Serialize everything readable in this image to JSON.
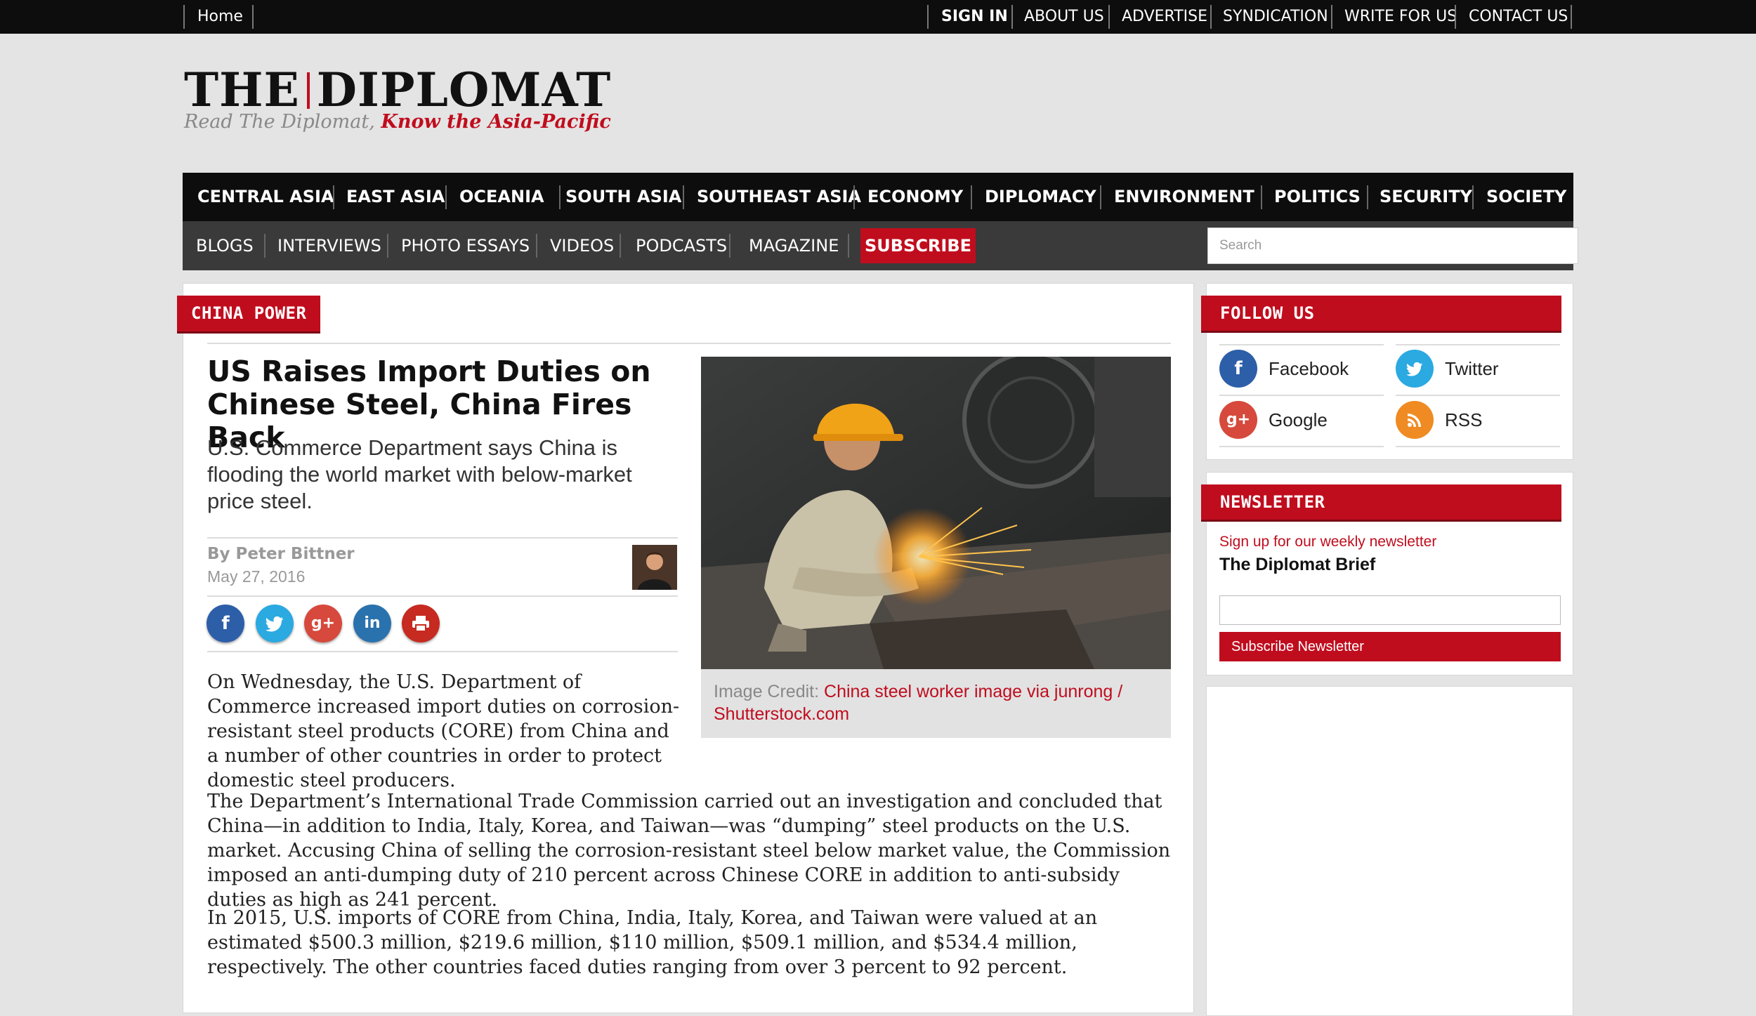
{
  "topbar": {
    "home": "Home",
    "sign_in": "SIGN IN",
    "about": "ABOUT US",
    "advertise": "ADVERTISE",
    "syndication": "SYNDICATION",
    "write": "WRITE FOR US",
    "contact": "CONTACT US"
  },
  "logo": {
    "word_left": "THE",
    "word_right": "DIPLOMAT",
    "tag_plain": "Read The Diplomat, ",
    "tag_bold": "Know the Asia-Pacific"
  },
  "nav_primary": [
    "CENTRAL ASIA",
    "EAST ASIA",
    "OCEANIA",
    "SOUTH ASIA",
    "SOUTHEAST ASIA",
    "ECONOMY",
    "DIPLOMACY",
    "ENVIRONMENT",
    "POLITICS",
    "SECURITY",
    "SOCIETY"
  ],
  "nav_secondary": [
    "BLOGS",
    "INTERVIEWS",
    "PHOTO ESSAYS",
    "VIDEOS",
    "PODCASTS",
    "MAGAZINE"
  ],
  "subscribe_label": "SUBSCRIBE",
  "search_placeholder": "Search",
  "article": {
    "section": "CHINA POWER",
    "headline": "US Raises Import Duties on Chinese Steel, China Fires Back",
    "dek": "U.S. Commerce Department says China is flooding the world market with below-market price steel.",
    "byline": "By Peter Bittner",
    "date": "May 27, 2016",
    "share_icons": [
      "facebook-icon",
      "twitter-icon",
      "google-plus-icon",
      "linkedin-icon",
      "print-icon"
    ],
    "caption_prefix": "Image Credit: ",
    "caption_credit": "China steel worker image via junrong / Shutterstock.com",
    "paragraphs": [
      "On Wednesday, the U.S. Department of Commerce increased import duties on corrosion-resistant steel products (CORE) from China and a number of other countries in order to protect domestic steel producers.",
      "The Department’s International Trade Commission carried out an investigation and concluded that China—in addition to India, Italy, Korea, and Taiwan—was “dumping” steel products on the U.S. market. Accusing China of selling the corrosion-resistant steel below market value, the Commission imposed an anti-dumping duty of 210 percent across Chinese CORE in addition to anti-subsidy duties as high as 241 percent.",
      "In 2015, U.S. imports of CORE from China, India, Italy, Korea, and Taiwan were valued at an estimated $500.3 million, $219.6 million, $110 million, $509.1 million, and $534.4 million, respectively. The other countries faced duties ranging from over 3 percent to 92 percent."
    ]
  },
  "sidebar": {
    "follow_title": "FOLLOW US",
    "follow": [
      {
        "label": "Facebook",
        "icon": "facebook-icon",
        "color": "#2d5ea8"
      },
      {
        "label": "Twitter",
        "icon": "twitter-icon",
        "color": "#2ba9e1"
      },
      {
        "label": "Google",
        "icon": "google-plus-icon",
        "color": "#d6493c"
      },
      {
        "label": "RSS",
        "icon": "rss-icon",
        "color": "#ef8b22"
      }
    ],
    "newsletter_title": "NEWSLETTER",
    "newsletter_sub": "Sign up for our weekly newsletter",
    "newsletter_name": "The Diplomat Brief",
    "newsletter_button": "Subscribe Newsletter"
  },
  "colors": {
    "brand_red": "#c00d1e",
    "nav_black": "#0d0d0d",
    "nav_gray": "#3a3a3a"
  }
}
